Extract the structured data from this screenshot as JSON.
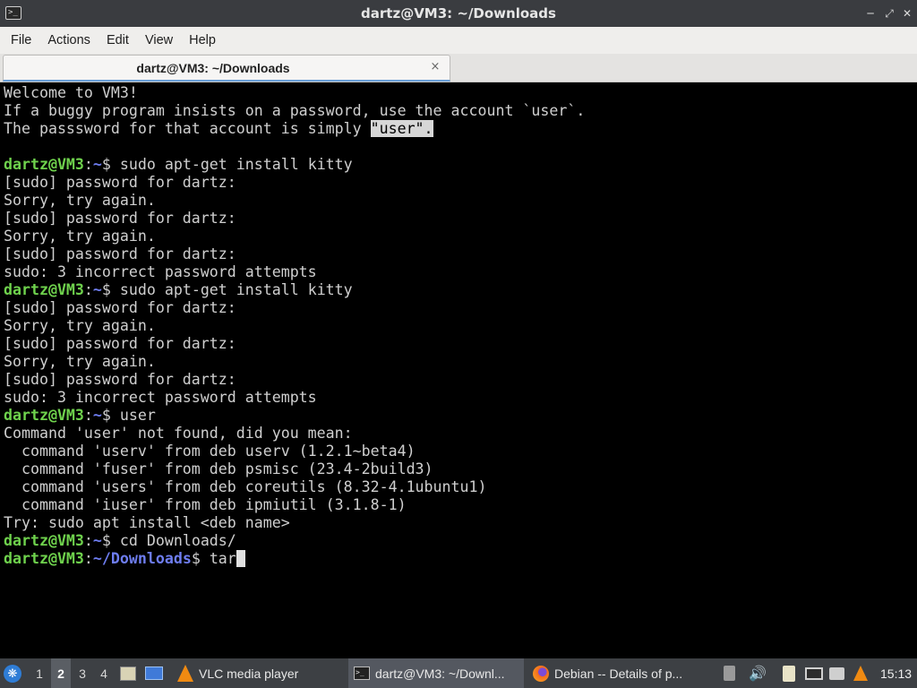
{
  "window": {
    "title": "dartz@VM3: ~/Downloads",
    "icon": "terminal-icon",
    "controls": [
      "minimize-icon",
      "restore-icon",
      "close-icon"
    ]
  },
  "menu": [
    "File",
    "Actions",
    "Edit",
    "View",
    "Help"
  ],
  "tab": {
    "label": "dartz@VM3: ~/Downloads",
    "close": "×"
  },
  "terminal": {
    "welcome": [
      "Welcome to VM3!",
      "If a buggy program insists on a password, use the account `user`.",
      "The passsword for that account is simply ",
      "\"user\"."
    ],
    "prompt_user": "dartz@VM3",
    "prompt_sep": ":",
    "home": "~",
    "downloads": "~/Downloads",
    "dollar": "$ ",
    "cmd_kitty": "sudo apt-get install kitty",
    "sudo_prompt": "[sudo] password for dartz:",
    "sorry": "Sorry, try again.",
    "incorrect": "sudo: 3 incorrect password attempts",
    "cmd_user": "user",
    "not_found": "Command 'user' not found, did you mean:",
    "suggestions": [
      "  command 'userv' from deb userv (1.2.1~beta4)",
      "  command 'fuser' from deb psmisc (23.4-2build3)",
      "  command 'users' from deb coreutils (8.32-4.1ubuntu1)",
      "  command 'iuser' from deb ipmiutil (3.1.8-1)"
    ],
    "try_line": "Try: sudo apt install <deb name>",
    "cmd_cd": "cd Downloads/",
    "cmd_current": "tar"
  },
  "taskbar": {
    "workspaces": [
      "1",
      "2",
      "3",
      "4"
    ],
    "active_workspace": "2",
    "tasks": [
      {
        "label": "VLC media player",
        "icon": "vlc-icon"
      },
      {
        "label": "dartz@VM3: ~/Downl...",
        "icon": "terminal-icon"
      },
      {
        "label": "Debian -- Details of p...",
        "icon": "firefox-icon"
      }
    ],
    "tray_icons": [
      "trash-icon",
      "volume-icon",
      "clipboard-icon",
      "monitor-icon",
      "chat-icon",
      "vlc-icon"
    ],
    "clock": "15:13",
    "accent": "#6fd24d",
    "path_color": "#6e7df0"
  }
}
